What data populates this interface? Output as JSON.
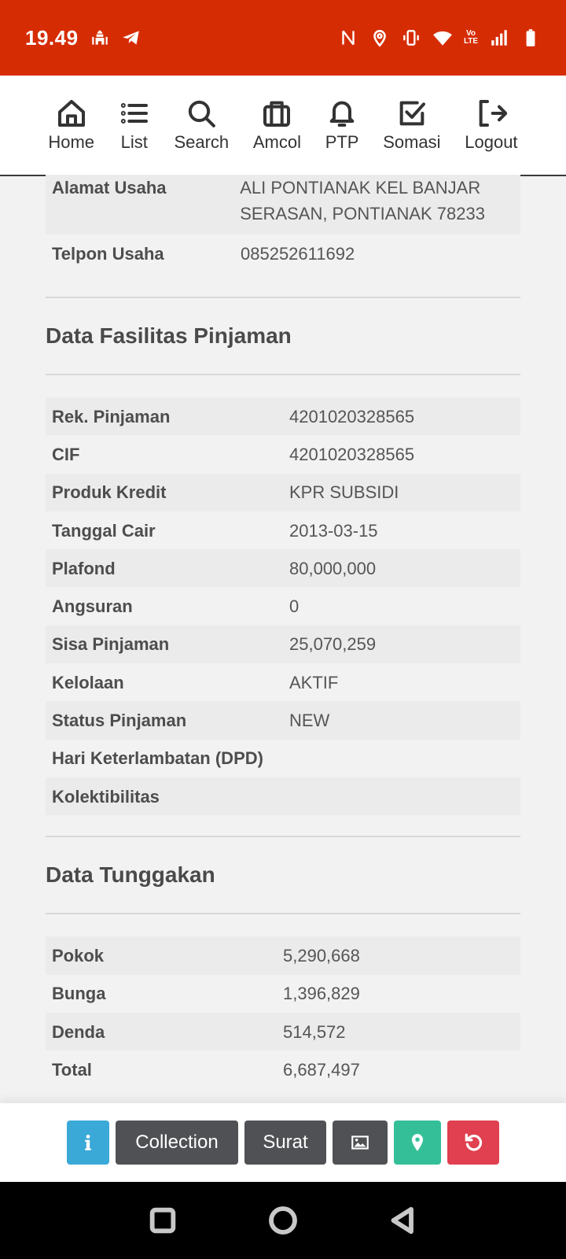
{
  "status_bar": {
    "time": "19.49",
    "left_icons": [
      "mosque-icon",
      "telegram-icon"
    ],
    "right_icons": [
      "nfc-icon",
      "location-icon",
      "vibrate-icon",
      "wifi-icon",
      "volte-icon",
      "signal-icon",
      "battery-icon"
    ],
    "volte_label": "Vo LTE"
  },
  "navbar": {
    "items": [
      {
        "label": "Home",
        "icon": "home-icon"
      },
      {
        "label": "List",
        "icon": "list-icon"
      },
      {
        "label": "Search",
        "icon": "search-icon"
      },
      {
        "label": "Amcol",
        "icon": "briefcase-icon"
      },
      {
        "label": "PTP",
        "icon": "bell-icon"
      },
      {
        "label": "Somasi",
        "icon": "check-square-icon"
      },
      {
        "label": "Logout",
        "icon": "logout-icon"
      }
    ]
  },
  "usaha": {
    "rows": [
      {
        "key": "Alamat Usaha",
        "value": "ALI PONTIANAK KEL BANJAR SERASAN, PONTIANAK 78233"
      },
      {
        "key": "Telpon Usaha",
        "value": "085252611692"
      }
    ]
  },
  "fasilitas": {
    "title": "Data Fasilitas Pinjaman",
    "rows": [
      {
        "key": "Rek. Pinjaman",
        "value": "4201020328565"
      },
      {
        "key": "CIF",
        "value": "4201020328565"
      },
      {
        "key": "Produk Kredit",
        "value": "KPR SUBSIDI"
      },
      {
        "key": "Tanggal Cair",
        "value": "2013-03-15"
      },
      {
        "key": "Plafond",
        "value": "80,000,000"
      },
      {
        "key": "Angsuran",
        "value": "0"
      },
      {
        "key": "Sisa Pinjaman",
        "value": "25,070,259"
      },
      {
        "key": "Kelolaan",
        "value": "AKTIF"
      },
      {
        "key": "Status Pinjaman",
        "value": "NEW"
      },
      {
        "key": "Hari Keterlambatan (DPD)",
        "value": ""
      },
      {
        "key": "Kolektibilitas",
        "value": ""
      }
    ]
  },
  "tunggakan": {
    "title": "Data Tunggakan",
    "rows": [
      {
        "key": "Pokok",
        "value": "5,290,668"
      },
      {
        "key": "Bunga",
        "value": "1,396,829"
      },
      {
        "key": "Denda",
        "value": "514,572"
      },
      {
        "key": "Total",
        "value": "6,687,497"
      }
    ]
  },
  "actions": {
    "info_icon": "info-icon",
    "collection_label": "Collection",
    "surat_label": "Surat",
    "image_icon": "image-icon",
    "map_icon": "map-marker-icon",
    "undo_icon": "undo-icon"
  },
  "colors": {
    "status_bar": "#d62c04",
    "info": "#3aa9d8",
    "dark": "#4f5154",
    "success": "#35bf98",
    "danger": "#e0404f"
  }
}
